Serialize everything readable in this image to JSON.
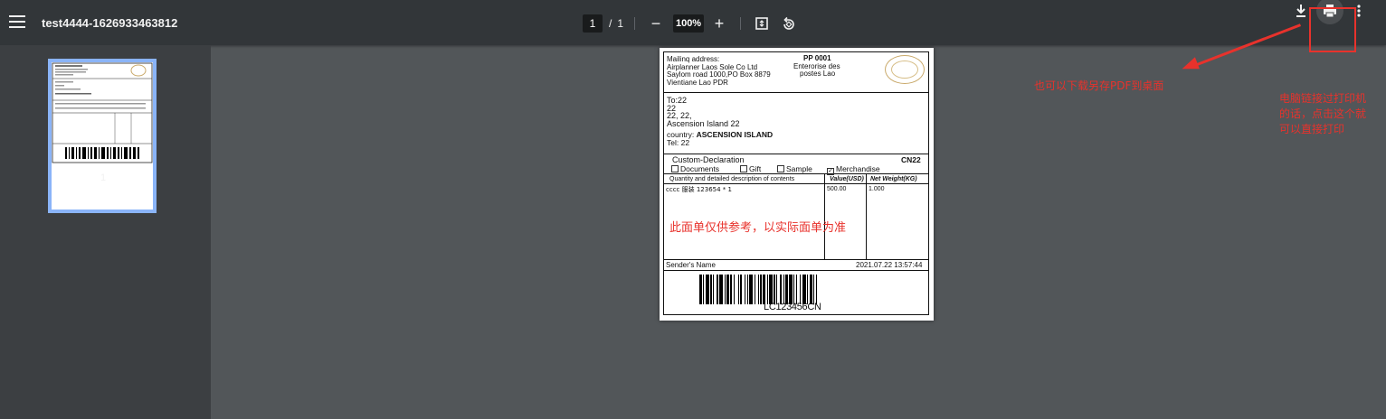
{
  "toolbar": {
    "title": "test4444-1626933463812",
    "page_current": "1",
    "page_sep": "/",
    "page_total": "1",
    "zoom": "100%",
    "zoom_out": "−",
    "zoom_in": "+",
    "icons": [
      "menu-icon",
      "fit-page-icon",
      "rotate-icon",
      "download-icon",
      "print-icon",
      "more-vert-icon"
    ]
  },
  "sidebar": {
    "thumb_page_number": "1"
  },
  "label": {
    "mailing_title": "Mailinq address:",
    "mailing_lines": [
      "Airplanner Laos Sole Co Ltd",
      "Saylom road 1000,PO Box 8879",
      "Vientiane Lao PDR"
    ],
    "pp_code": "PP 0001",
    "post_name_1": "Enterorise des",
    "post_name_2": "postes Lao",
    "to_lines": [
      "To:22",
      "22",
      "22, 22,",
      "Ascension Island 22"
    ],
    "country_label": "country:",
    "country_value": "ASCENSION ISLAND",
    "tel": "Tel: 22",
    "customs_title": "Custom-Declaration",
    "customs_code": "CN22",
    "checkboxes": [
      {
        "label": "Documents",
        "checked": false
      },
      {
        "label": "Gift",
        "checked": false
      },
      {
        "label": "Sample",
        "checked": false
      },
      {
        "label": "Merchandise",
        "checked": true
      }
    ],
    "col_desc": "Quantity and detailed description of contents",
    "col_value": "Value(USD)",
    "col_weight": "Net Weight(KG)",
    "row_desc": "cccc 服装 123654 * 1",
    "row_value": "500.00",
    "row_weight": "1.000",
    "watermark": "此面单仅供参考，以实际面单为准",
    "sender_label": "Sender's Name",
    "date": "2021.07.22 13:57:44",
    "barcode_text": "LC123456CN"
  },
  "annotations": {
    "download_note": "也可以下载另存PDF到桌面",
    "print_note": "电脑链接过打印机的话，点击这个就可以直接打印",
    "color": "#e8322c"
  }
}
